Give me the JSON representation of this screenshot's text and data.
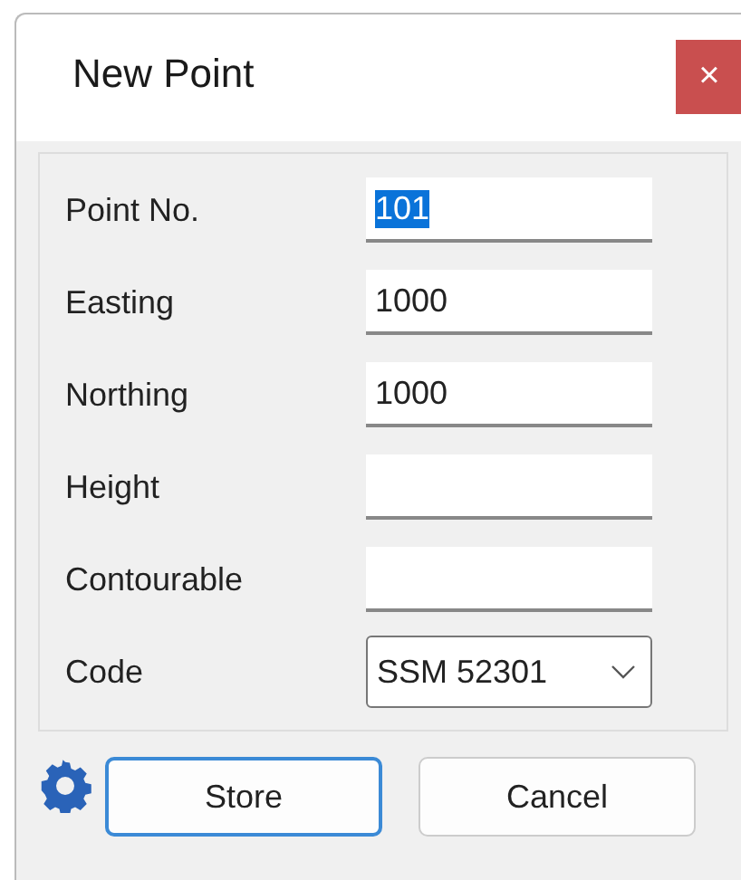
{
  "window": {
    "title": "New Point",
    "close": "×"
  },
  "fields": [
    {
      "kind": "text",
      "label": "Point No.",
      "value": "101",
      "selected": true
    },
    {
      "kind": "text",
      "label": "Easting",
      "value": "1000",
      "selected": false
    },
    {
      "kind": "text",
      "label": "Northing",
      "value": "1000",
      "selected": false
    },
    {
      "kind": "text",
      "label": "Height",
      "selected": false
    },
    {
      "kind": "text",
      "label": "Contourable",
      "selected": false
    },
    {
      "kind": "dropdown",
      "label": "Code",
      "value": "SSM 52301",
      "selected": false
    }
  ],
  "buttons": [
    {
      "label": "Store",
      "focused": true
    },
    {
      "label": "Cancel",
      "focused": false
    }
  ]
}
